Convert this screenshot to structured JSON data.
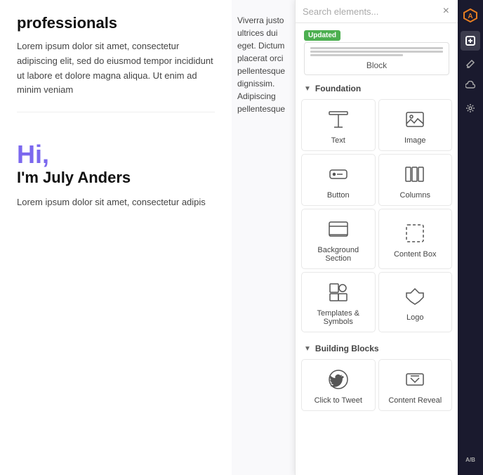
{
  "content": {
    "top_heading": "professionals",
    "top_body": "Lorem ipsum dolor sit amet, consectetur adipiscing elit, sed do eiusmod tempor incididunt ut labore et dolore magna aliqua. Ut enim ad minim veniam",
    "right_text": "Viverra justo ultrices dui eget. Dictum placerat orci pellentesque dignissim. Adipiscing pellentesque",
    "hi_text": "Hi,",
    "name_text": "I'm July Anders",
    "bottom_body": "Lorem ipsum dolor sit amet, consectetur adipis"
  },
  "panel": {
    "search_placeholder": "Search elements...",
    "close_label": "×",
    "updated_badge": "Updated",
    "updated_block_label": "Block",
    "foundation_label": "Foundation",
    "building_blocks_label": "Building Blocks",
    "elements": [
      {
        "id": "text",
        "label": "Text",
        "icon": "text"
      },
      {
        "id": "image",
        "label": "Image",
        "icon": "image"
      },
      {
        "id": "button",
        "label": "Button",
        "icon": "button"
      },
      {
        "id": "columns",
        "label": "Columns",
        "icon": "columns"
      },
      {
        "id": "background-section",
        "label": "Background Section",
        "icon": "background"
      },
      {
        "id": "content-box",
        "label": "Content Box",
        "icon": "contentbox"
      },
      {
        "id": "templates-symbols",
        "label": "Templates & Symbols",
        "icon": "templates"
      },
      {
        "id": "logo",
        "label": "Logo",
        "icon": "logo"
      }
    ],
    "building_blocks_elements": [
      {
        "id": "click-to-tweet",
        "label": "Click to Tweet",
        "icon": "tweet"
      },
      {
        "id": "content-reveal",
        "label": "Content Reveal",
        "icon": "reveal"
      }
    ]
  },
  "toolbar": {
    "logo_symbol": "A",
    "add_icon": "+",
    "edit_icon": "✏",
    "cloud_icon": "☁",
    "settings_icon": "⚙",
    "ab_icon": "A/B"
  }
}
